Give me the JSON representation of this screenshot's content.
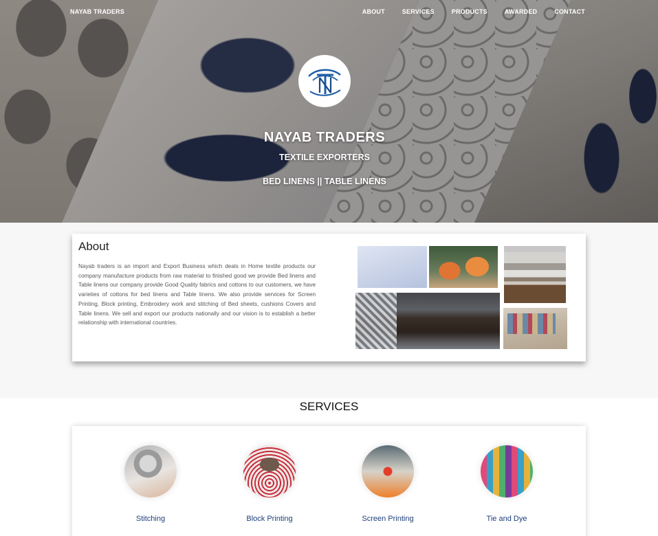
{
  "nav": {
    "brand": "NAYAB TRADERS",
    "links": [
      "ABOUT",
      "SERVICES",
      "PRODUCTS",
      "AWARDED",
      "CONTACT"
    ]
  },
  "hero": {
    "title": "NAYAB  TRADERS",
    "subtitle": "TEXTILE  EXPORTERS",
    "tagline": "BED LINENS  ||  TABLE LINENS"
  },
  "about": {
    "title": "About",
    "text": "Nayab traders is an import and Export Business which deals in Home textile products our company manufacture products from raw material to finished good we provide Bed linens and Table linens our company provide Good Quality fabrics and cottons to our customers, we have varieties of cottons for bed linens and Table linens. We also provide services for Screen Printing, Block printing, Embroidery work and stitching of Bed sheets, cushions Covers and Table linens. We sell and export our products nationally and our vision is to establish a better relationship with international countries."
  },
  "services": {
    "title": "SERVICES",
    "items": [
      {
        "label": "Stitching"
      },
      {
        "label": "Block Printing"
      },
      {
        "label": "Screen Printing"
      },
      {
        "label": "Tie and Dye"
      }
    ]
  },
  "colors": {
    "logo_blue": "#1f5fa8",
    "service_label": "#1d3f7a"
  }
}
